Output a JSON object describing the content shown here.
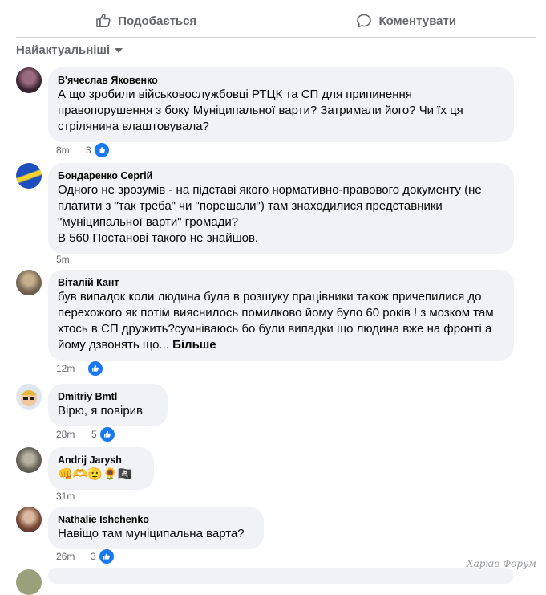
{
  "actions": {
    "like_label": "Подобається",
    "comment_label": "Коментувати"
  },
  "sort": {
    "label": "Найактуальніші"
  },
  "comments": [
    {
      "author": "В'ячеслав Яковенко",
      "text": "А що зробили військовослужбовці РТЦК та СП для припинення\nправопорушення з боку Муніципальної варти? Затримали його? Чи їх ця\nстрілянина влаштовувала?",
      "time": "8m",
      "likes": "3"
    },
    {
      "author": "Бондаренко Сергій",
      "text": "Одного не зрозумів - на підставі якого нормативно-правового документу (не\nплатити з \"так треба\" чи \"порешали\") там знаходилися представники\n\"муніципальної варти\" громади?\nВ 560 Постанові такого не знайшов.",
      "time": "5m",
      "likes": ""
    },
    {
      "author": "Віталій Кант",
      "text": "був випадок коли людина була в розшуку працівники також причепилися до\nперехожого як потім вияснилось помилково йому було 60 років ! з мозком там\nхтось в СП дружить?сумніваюсь бо були випадки що людина вже на фронті а\nйому дзвонять що...",
      "more": "Більше",
      "time": "12m",
      "likes": ""
    },
    {
      "author": "Dmitriy Bmtl",
      "text": "Вірю, я повірив",
      "time": "28m",
      "likes": "5"
    },
    {
      "author": "Andrij Jarysh",
      "text": "👊🫶🫡🌻🏴‍☠️",
      "time": "31m",
      "likes": ""
    },
    {
      "author": "Nathalie Ishchenko",
      "text": "Навіщо там муніципальна варта?",
      "time": "26m",
      "likes": "3"
    }
  ],
  "watermark": "Харків Форум",
  "colors": {
    "accent": "#1877f2",
    "bubble": "#f0f2f5",
    "muted": "#65676b"
  }
}
